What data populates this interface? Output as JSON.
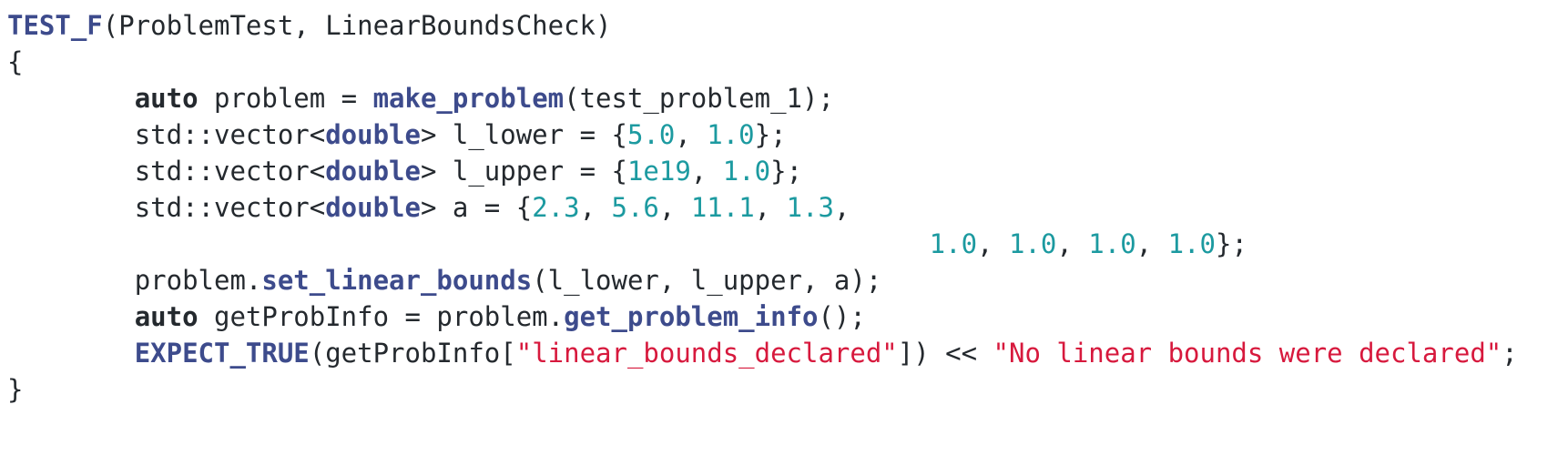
{
  "code": {
    "line1": {
      "macro": "TEST_F",
      "rest": "(ProblemTest, LinearBoundsCheck)"
    },
    "line2": {
      "text": "{"
    },
    "line3": {
      "indent": "        ",
      "kw": "auto",
      "mid": " problem = ",
      "fn": "make_problem",
      "rest": "(test_problem_1);"
    },
    "line4": {
      "indent": "        ",
      "pre": "std::vector<",
      "type": "double",
      "mid": "> l_lower = {",
      "n1": "5.0",
      "sep1": ", ",
      "n2": "1.0",
      "end": "};"
    },
    "line5": {
      "indent": "        ",
      "pre": "std::vector<",
      "type": "double",
      "mid": "> l_upper = {",
      "n1": "1e19",
      "sep1": ", ",
      "n2": "1.0",
      "end": "};"
    },
    "line6": {
      "indent": "        ",
      "pre": "std::vector<",
      "type": "double",
      "mid": "> a = {",
      "n1": "2.3",
      "sep1": ", ",
      "n2": "5.6",
      "sep2": ", ",
      "n3": "11.1",
      "sep3": ", ",
      "n4": "1.3",
      "end": ","
    },
    "line7": {
      "indent": "                                                          ",
      "n1": "1.0",
      "sep1": ", ",
      "n2": "1.0",
      "sep2": ", ",
      "n3": "1.0",
      "sep3": ", ",
      "n4": "1.0",
      "end": "};"
    },
    "line8": {
      "indent": "        ",
      "pre": "problem.",
      "fn": "set_linear_bounds",
      "rest": "(l_lower, l_upper, a);"
    },
    "line9": {
      "indent": "        ",
      "kw": "auto",
      "mid": " getProbInfo = problem.",
      "fn": "get_problem_info",
      "rest": "();"
    },
    "line10": {
      "indent": "        ",
      "macro": "EXPECT_TRUE",
      "mid": "(getProbInfo[",
      "str1": "\"linear_bounds_declared\"",
      "mid2": "]) << ",
      "str2": "\"No linear bounds were declared\"",
      "end": ";"
    },
    "line11": {
      "text": "}"
    }
  },
  "colors": {
    "function": "#3d4b8c",
    "number": "#1c9aa0",
    "string": "#d7193d",
    "text": "#24292e",
    "background": "#ffffff"
  }
}
